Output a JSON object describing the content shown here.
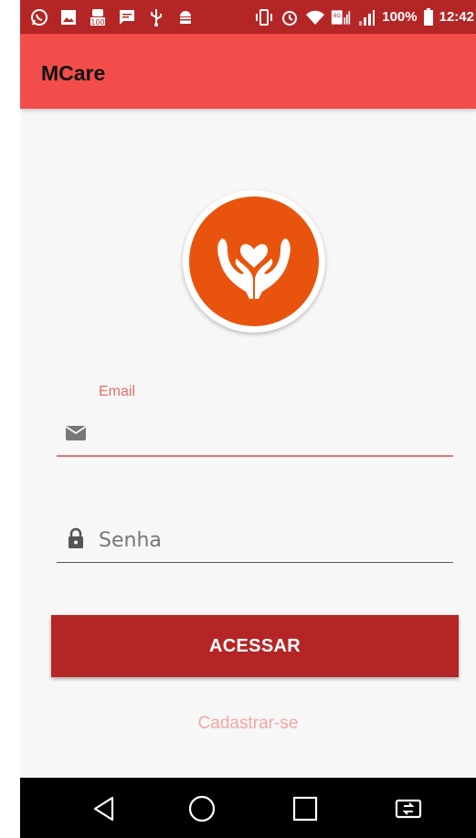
{
  "status_bar": {
    "left_icons": [
      "whatsapp-icon",
      "gallery-icon",
      "notification-100-icon",
      "message-icon",
      "usb-icon",
      "android-icon"
    ],
    "right_icons": [
      "vibrate-icon",
      "alarm-icon",
      "wifi-icon",
      "signal-4g-icon",
      "signal-icon"
    ],
    "battery": "100%",
    "time": "12:42"
  },
  "app_bar": {
    "title": "MCare"
  },
  "logo": {
    "icon": "hands-heart-icon",
    "color": "#e8540e"
  },
  "form": {
    "email_label": "Email",
    "email_value": "",
    "password_placeholder": "Senha",
    "submit_label": "ACESSAR",
    "register_link": "Cadastrar-se"
  },
  "nav_bar": {
    "icons": [
      "back-icon",
      "home-icon",
      "recents-icon",
      "screen-rotate-icon"
    ]
  },
  "colors": {
    "primary": "#f24d4a",
    "primary_dark": "#b42626",
    "accent": "#e57373",
    "logo": "#e8540e"
  }
}
